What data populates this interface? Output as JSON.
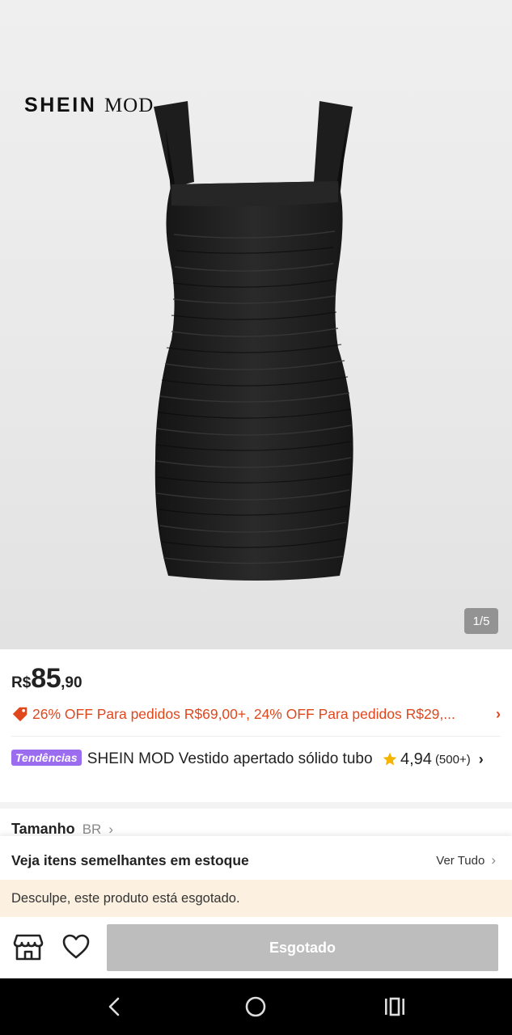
{
  "gallery": {
    "brand_logo_text": {
      "main": "SHEIN",
      "sub": "MOD"
    },
    "page_indicator": "1/5",
    "current_image": 1,
    "total_images": 5
  },
  "price": {
    "currency": "R$",
    "integer": "85",
    "decimals": ",90"
  },
  "promo": {
    "icon": "tag-icon",
    "text": "26% OFF Para pedidos R$69,00+,  24% OFF Para pedidos R$29,...",
    "color": "#e0471d"
  },
  "product": {
    "badge": "Tendências",
    "badge_color": "#9b6cf0",
    "title": "SHEIN MOD Vestido apertado sólido tubo"
  },
  "rating": {
    "icon": "star-icon",
    "score": "4,94",
    "count": "(500+)",
    "star_color": "#f5b400"
  },
  "size": {
    "label": "Tamanho",
    "system": "BR"
  },
  "similar": {
    "title": "Veja itens semelhantes em estoque",
    "link": "Ver Tudo"
  },
  "soldout_message": "Desculpe, este produto está esgotado.",
  "actions": {
    "store_icon": "store-icon",
    "wishlist_icon": "heart-icon",
    "cta_label": "Esgotado",
    "cta_color": "#bdbdbd"
  },
  "system_nav": {
    "back": "back-icon",
    "home": "home-icon",
    "recents": "recents-icon"
  }
}
